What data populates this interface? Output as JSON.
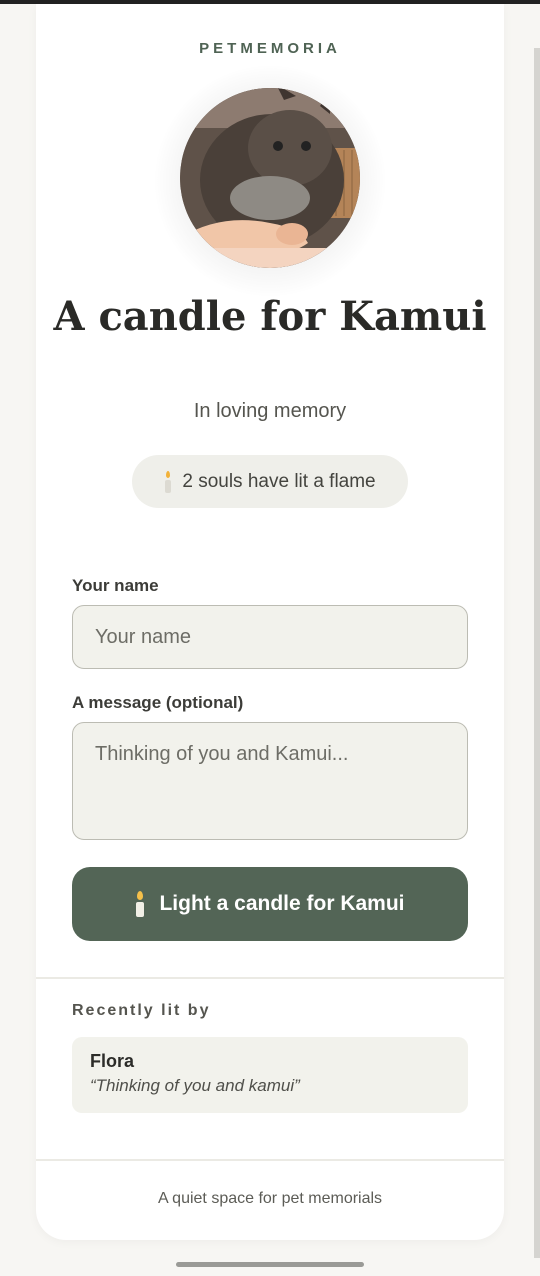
{
  "brand": "PETMEMORIA",
  "pet": {
    "photo_icon": "cat-photo",
    "title": "A candle for Kamui",
    "subtitle": "In loving memory"
  },
  "stats": {
    "souls_text": "2 souls have lit a flame"
  },
  "form": {
    "name_label": "Your name",
    "name_placeholder": "Your name",
    "message_label": "A message (optional)",
    "message_placeholder": "Thinking of you and Kamui...",
    "submit_label": "Light a candle for Kamui"
  },
  "recent": {
    "heading": "Recently lit by",
    "entries": [
      {
        "name": "Flora",
        "message": "“Thinking of you and kamui”"
      }
    ]
  },
  "footer": "A quiet space for pet memorials",
  "colors": {
    "accent": "#536556",
    "brand_text": "#4f6354",
    "field_bg": "#f2f2ec",
    "page_bg": "#f7f6f3"
  }
}
